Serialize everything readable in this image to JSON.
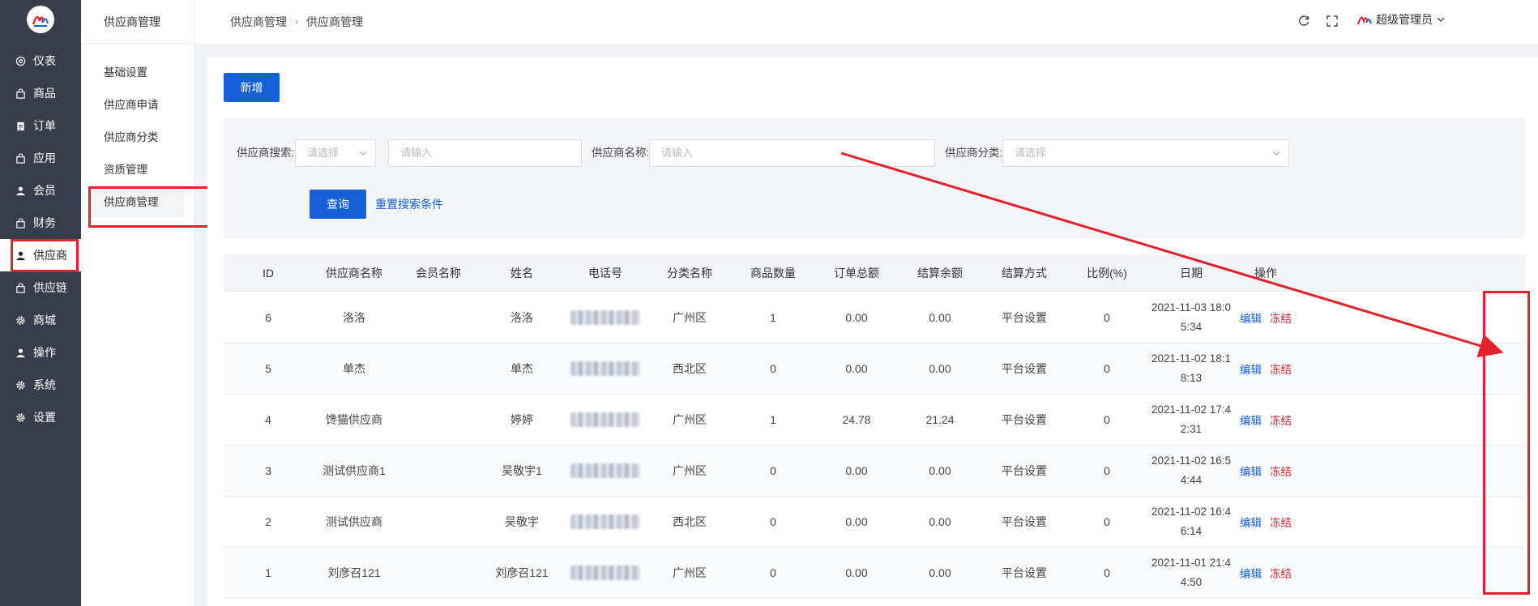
{
  "colors": {
    "sidebar_bg": "#393d49",
    "primary": "#1560d8",
    "annotation": "#e5202b"
  },
  "sidebar": {
    "items": [
      {
        "label": "仪表",
        "icon": "dashboard-icon"
      },
      {
        "label": "商品",
        "icon": "bag-icon"
      },
      {
        "label": "订单",
        "icon": "clipboard-icon"
      },
      {
        "label": "应用",
        "icon": "bag-icon"
      },
      {
        "label": "会员",
        "icon": "user-icon"
      },
      {
        "label": "财务",
        "icon": "bag-icon"
      },
      {
        "label": "供应商",
        "icon": "user-icon",
        "active": true
      },
      {
        "label": "供应链",
        "icon": "bag-icon"
      },
      {
        "label": "商城",
        "icon": "gear-icon"
      },
      {
        "label": "操作",
        "icon": "user-icon"
      },
      {
        "label": "系统",
        "icon": "gear-icon"
      },
      {
        "label": "设置",
        "icon": "gear-icon"
      }
    ]
  },
  "subbar": {
    "title": "供应商管理",
    "items": [
      "基础设置",
      "供应商申请",
      "供应商分类",
      "资质管理",
      "供应商管理"
    ]
  },
  "header": {
    "breadcrumb": [
      "供应商管理",
      "供应商管理"
    ],
    "user": "超级管理员"
  },
  "toolbar": {
    "new_label": "新增"
  },
  "filter": {
    "search_label": "供应商搜索:",
    "search_select_placeholder": "请选择",
    "search_input_placeholder": "请输入",
    "name_label": "供应商名称:",
    "name_placeholder": "请输入",
    "category_label": "供应商分类:",
    "category_placeholder": "请选择",
    "query_label": "查询",
    "reset_label": "重置搜索条件"
  },
  "table": {
    "columns": [
      "ID",
      "供应商名称",
      "会员名称",
      "姓名",
      "电话号",
      "分类名称",
      "商品数量",
      "订单总额",
      "结算余额",
      "结算方式",
      "比例(%)",
      "日期",
      "操作"
    ],
    "edit_label": "编辑",
    "freeze_label": "冻结",
    "rows": [
      {
        "id": "6",
        "name": "洛洛",
        "member": "",
        "person": "洛洛",
        "category": "广州区",
        "goods": "1",
        "total": "0.00",
        "balance": "0.00",
        "method": "平台设置",
        "ratio": "0",
        "date": "2021-11-03 18:0\n5:34"
      },
      {
        "id": "5",
        "name": "单杰",
        "member": "",
        "person": "单杰",
        "category": "西北区",
        "goods": "0",
        "total": "0.00",
        "balance": "0.00",
        "method": "平台设置",
        "ratio": "0",
        "date": "2021-11-02 18:1\n8:13"
      },
      {
        "id": "4",
        "name": "馋猫供应商",
        "member": "",
        "person": "婷婷",
        "category": "广州区",
        "goods": "1",
        "total": "24.78",
        "balance": "21.24",
        "method": "平台设置",
        "ratio": "0",
        "date": "2021-11-02 17:4\n2:31"
      },
      {
        "id": "3",
        "name": "测试供应商1",
        "member": "",
        "person": "吴敬宇1",
        "category": "广州区",
        "goods": "0",
        "total": "0.00",
        "balance": "0.00",
        "method": "平台设置",
        "ratio": "0",
        "date": "2021-11-02 16:5\n4:44"
      },
      {
        "id": "2",
        "name": "测试供应商",
        "member": "",
        "person": "吴敬宇",
        "category": "西北区",
        "goods": "0",
        "total": "0.00",
        "balance": "0.00",
        "method": "平台设置",
        "ratio": "0",
        "date": "2021-11-02 16:4\n6:14"
      },
      {
        "id": "1",
        "name": "刘彦召121",
        "member": "",
        "person": "刘彦召121",
        "category": "广州区",
        "goods": "0",
        "total": "0.00",
        "balance": "0.00",
        "method": "平台设置",
        "ratio": "0",
        "date": "2021-11-01 21:4\n4:50"
      }
    ]
  }
}
